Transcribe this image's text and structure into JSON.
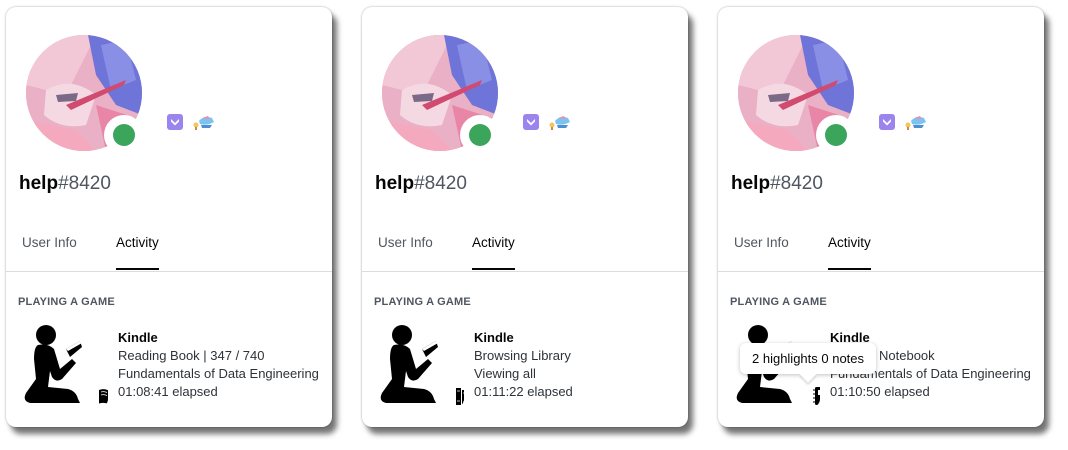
{
  "colors": {
    "status_online": "#3ba55c",
    "text_primary": "#060607",
    "text_muted": "#4f5660",
    "card_bg": "#ffffff"
  },
  "icons": {
    "status": "online-dot",
    "badge_1": "hypesquad-badge",
    "badge_2": "early-supporter-badge",
    "game": "kindle-reader-logo"
  },
  "cards": [
    {
      "username": "help",
      "discriminator": "#8420",
      "tabs": [
        {
          "label": "User Info"
        },
        {
          "label": "Activity"
        }
      ],
      "section_title": "PLAYING A GAME",
      "activity": {
        "game": "Kindle",
        "line1": "Reading Book | 347 / 740",
        "line2": "Fundamentals of Data Engineering",
        "elapsed": "01:08:41 elapsed",
        "small_icon": "open-book-icon"
      }
    },
    {
      "username": "help",
      "discriminator": "#8420",
      "tabs": [
        {
          "label": "User Info"
        },
        {
          "label": "Activity"
        }
      ],
      "section_title": "PLAYING A GAME",
      "activity": {
        "game": "Kindle",
        "line1": "Browsing Library",
        "line2": "Viewing all",
        "elapsed": "01:11:22 elapsed",
        "small_icon": "books-on-shelf-icon"
      }
    },
    {
      "username": "help",
      "discriminator": "#8420",
      "tabs": [
        {
          "label": "User Info"
        },
        {
          "label": "Activity"
        }
      ],
      "section_title": "PLAYING A GAME",
      "activity": {
        "game": "Kindle",
        "line1": "Notebook",
        "line2": "Fundamentals of Data Engineering",
        "elapsed": "01:10:50 elapsed",
        "small_icon": "notebook-icon"
      },
      "tooltip": "2 highlights 0 notes"
    }
  ]
}
